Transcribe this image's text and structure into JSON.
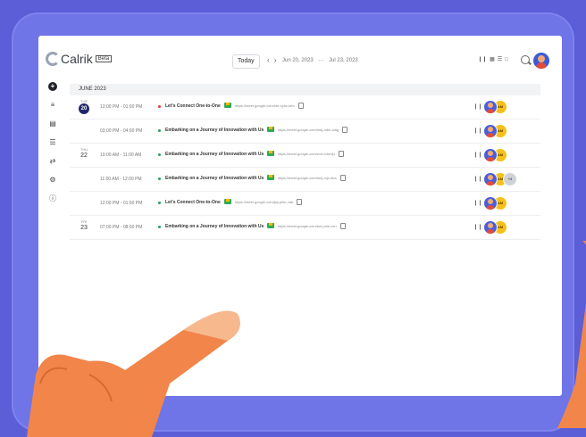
{
  "app": {
    "name": "Calrik",
    "badge": "Beta"
  },
  "toolbar": {
    "today_label": "Today",
    "prev_icon": "chevron-left-icon",
    "next_icon": "chevron-right-icon",
    "date_start": "Jun 20, 2023",
    "date_sep": "—",
    "date_end": "Jul 23, 2023",
    "view_icons": [
      "columns-icon",
      "calendar-icon",
      "list-icon",
      "square-icon"
    ],
    "search_icon": "search-icon"
  },
  "sidebar": {
    "icons": [
      "add-icon",
      "sliders-icon",
      "calendar-icon",
      "list-icon",
      "transfer-icon",
      "settings-icon",
      "help-icon"
    ]
  },
  "month": "JUNE 2023",
  "events": [
    {
      "dow": "TUE",
      "day": "20",
      "is_today": true,
      "time": "12:00 PM - 01:00 PM",
      "title": "Let's Connect One-to-One",
      "dot": "#e53935",
      "link": "https://meet.google.com/xbr-xyhz-kfm",
      "avatars": [
        "blue",
        "yellow"
      ],
      "yellow_text": "AM",
      "extra": ""
    },
    {
      "dow": "",
      "day": "",
      "is_today": false,
      "time": "03:00 PM - 04:00 PM",
      "title": "Embarking on a Journey of Innovation with Us",
      "dot": "#2e9e5b",
      "link": "https://meet.google.com/mej-ndm-wag",
      "avatars": [
        "blue",
        "yellow"
      ],
      "yellow_text": "AM",
      "extra": ""
    },
    {
      "dow": "THU",
      "day": "22",
      "is_today": false,
      "time": "10:00 AM - 11:00 AM",
      "title": "Embarking on a Journey of Innovation with Us",
      "dot": "#2e9e5b",
      "link": "https://meet.google.com/zxd-vdm-fjx",
      "avatars": [
        "blue",
        "yellow"
      ],
      "yellow_text": "AM",
      "extra": ""
    },
    {
      "dow": "",
      "day": "",
      "is_today": false,
      "time": "11:00 AM - 12:00 PM",
      "title": "Embarking on a Journey of Innovation with Us",
      "dot": "#2e9e5b",
      "link": "https://meet.google.com/mnj-rcjx-bka",
      "avatars": [
        "blue",
        "yellow",
        "gray"
      ],
      "yellow_text": "AM",
      "extra": "+3"
    },
    {
      "dow": "",
      "day": "",
      "is_today": false,
      "time": "12:00 PM - 01:00 PM",
      "title": "Let's Connect One-to-One",
      "dot": "#2e9e5b",
      "link": "https://meet.google.com/jwj-phkr-zab",
      "avatars": [
        "blue",
        "yellow"
      ],
      "yellow_text": "AM",
      "extra": ""
    },
    {
      "dow": "FRI",
      "day": "23",
      "is_today": false,
      "time": "07:00 PM - 08:00 PM",
      "title": "Embarking on a Journey of Innovation with Us",
      "dot": "#2e9e5b",
      "link": "https://meet.google.com/bzf-pnie-cxn",
      "avatars": [
        "blue",
        "yellow"
      ],
      "yellow_text": "AM",
      "extra": ""
    }
  ]
}
